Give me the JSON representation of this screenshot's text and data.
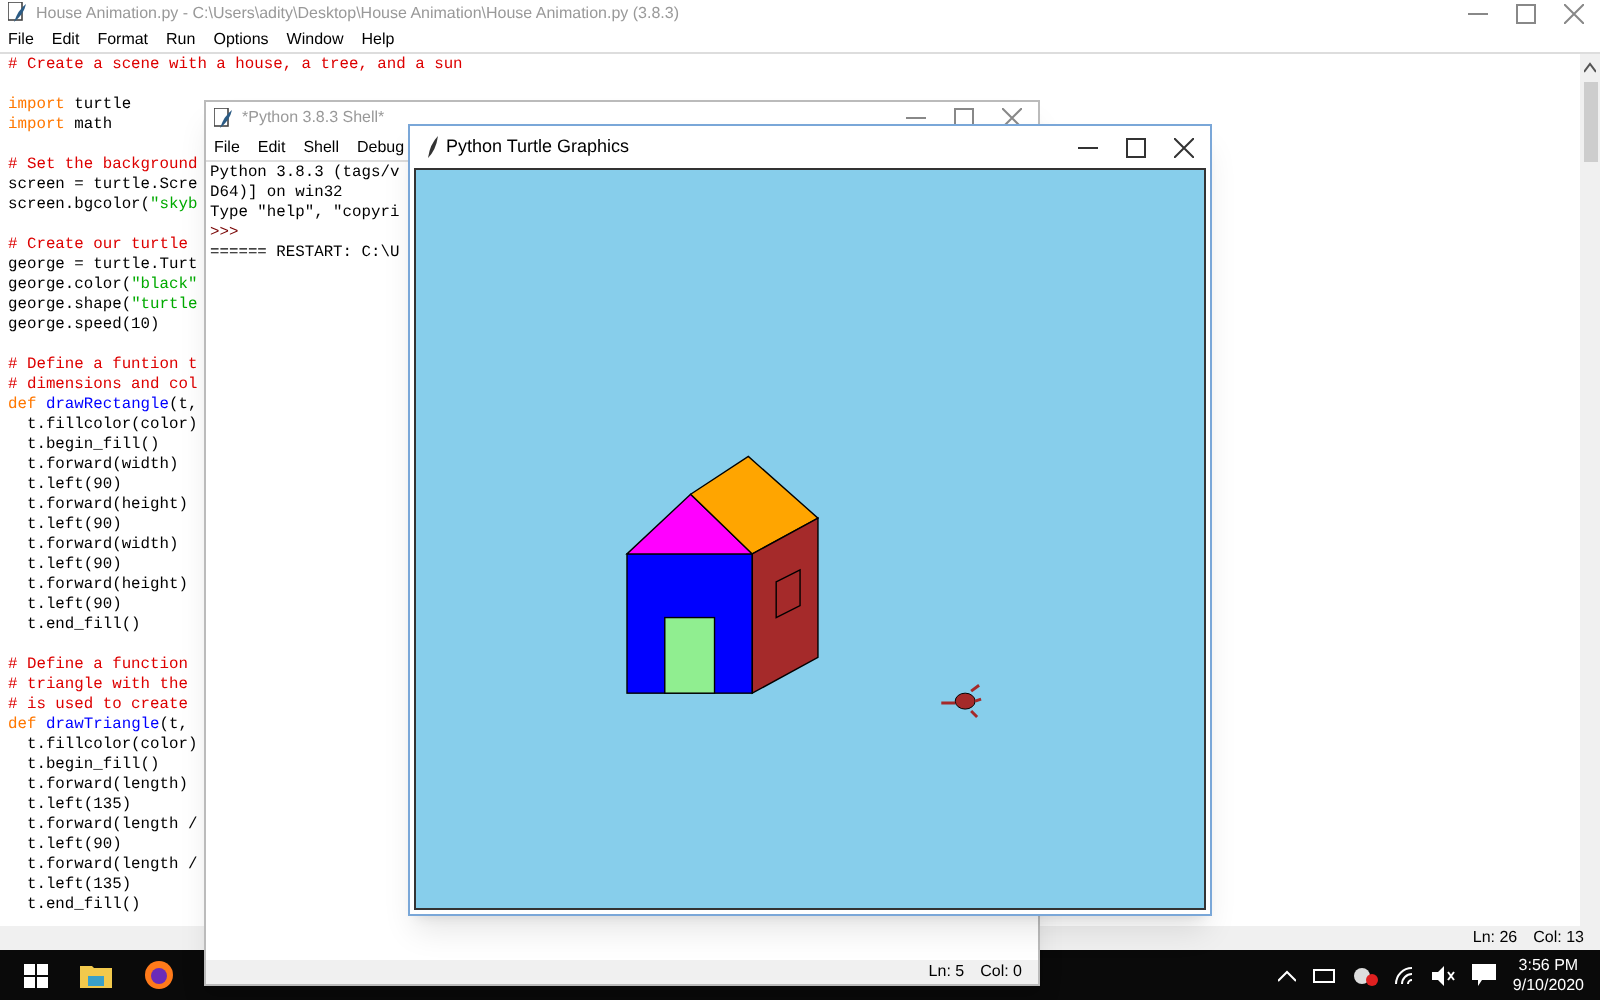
{
  "editor": {
    "title": "House Animation.py - C:\\Users\\adity\\Desktop\\House Animation\\House Animation.py (3.8.3)",
    "menu": [
      "File",
      "Edit",
      "Format",
      "Run",
      "Options",
      "Window",
      "Help"
    ],
    "code_blocks": [
      [
        [
          {
            "kind": "comment",
            "text": "# Create a scene with a house, a tree, and a sun"
          }
        ]
      ],
      [
        [
          {
            "kind": "keyword",
            "text": "import"
          },
          {
            "kind": "plain",
            "text": " turtle"
          }
        ],
        [
          {
            "kind": "keyword",
            "text": "import"
          },
          {
            "kind": "plain",
            "text": " math"
          }
        ]
      ],
      [
        [
          {
            "kind": "comment",
            "text": "# Set the background"
          }
        ],
        [
          {
            "kind": "plain",
            "text": "screen = turtle.Scre"
          }
        ],
        [
          {
            "kind": "plain",
            "text": "screen.bgcolor("
          },
          {
            "kind": "string",
            "text": "\"skyb"
          }
        ]
      ],
      [
        [
          {
            "kind": "comment",
            "text": "# Create our turtle"
          }
        ],
        [
          {
            "kind": "plain",
            "text": "george = turtle.Turt"
          }
        ],
        [
          {
            "kind": "plain",
            "text": "george.color("
          },
          {
            "kind": "string",
            "text": "\"black\""
          }
        ],
        [
          {
            "kind": "plain",
            "text": "george.shape("
          },
          {
            "kind": "string",
            "text": "\"turtle"
          }
        ],
        [
          {
            "kind": "plain",
            "text": "george.speed(10)"
          }
        ]
      ],
      [
        [
          {
            "kind": "comment",
            "text": "# Define a funtion t"
          }
        ],
        [
          {
            "kind": "comment",
            "text": "# dimensions and col"
          }
        ],
        [
          {
            "kind": "keyword",
            "text": "def"
          },
          {
            "kind": "name",
            "text": " drawRectangle"
          },
          {
            "kind": "plain",
            "text": "(t,"
          }
        ],
        [
          {
            "kind": "plain",
            "text": "  t.fillcolor(color)"
          }
        ],
        [
          {
            "kind": "plain",
            "text": "  t.begin_fill()"
          }
        ],
        [
          {
            "kind": "plain",
            "text": "  t.forward(width)"
          }
        ],
        [
          {
            "kind": "plain",
            "text": "  t.left(90)"
          }
        ],
        [
          {
            "kind": "plain",
            "text": "  t.forward(height)"
          }
        ],
        [
          {
            "kind": "plain",
            "text": "  t.left(90)"
          }
        ],
        [
          {
            "kind": "plain",
            "text": "  t.forward(width)"
          }
        ],
        [
          {
            "kind": "plain",
            "text": "  t.left(90)"
          }
        ],
        [
          {
            "kind": "plain",
            "text": "  t.forward(height)"
          }
        ],
        [
          {
            "kind": "plain",
            "text": "  t.left(90)"
          }
        ],
        [
          {
            "kind": "plain",
            "text": "  t.end_fill()"
          }
        ]
      ],
      [
        [
          {
            "kind": "comment",
            "text": "# Define a function"
          }
        ],
        [
          {
            "kind": "comment",
            "text": "# triangle with the"
          }
        ],
        [
          {
            "kind": "comment",
            "text": "# is used to create"
          }
        ],
        [
          {
            "kind": "keyword",
            "text": "def"
          },
          {
            "kind": "name",
            "text": " drawTriangle"
          },
          {
            "kind": "plain",
            "text": "(t,"
          }
        ],
        [
          {
            "kind": "plain",
            "text": "  t.fillcolor(color)"
          }
        ],
        [
          {
            "kind": "plain",
            "text": "  t.begin_fill()"
          }
        ],
        [
          {
            "kind": "plain",
            "text": "  t.forward(length)"
          }
        ],
        [
          {
            "kind": "plain",
            "text": "  t.left(135)"
          }
        ],
        [
          {
            "kind": "plain",
            "text": "  t.forward(length /"
          }
        ],
        [
          {
            "kind": "plain",
            "text": "  t.left(90)"
          }
        ],
        [
          {
            "kind": "plain",
            "text": "  t.forward(length /"
          }
        ],
        [
          {
            "kind": "plain",
            "text": "  t.left(135)"
          }
        ],
        [
          {
            "kind": "plain",
            "text": "  t.end_fill()"
          }
        ]
      ]
    ],
    "status": {
      "line": "Ln: 26",
      "column": "Col: 13"
    }
  },
  "shell": {
    "title": "*Python 3.8.3 Shell*",
    "menu": [
      "File",
      "Edit",
      "Shell",
      "Debug"
    ],
    "lines": [
      {
        "kind": "output",
        "text": "Python 3.8.3 (tags/v"
      },
      {
        "kind": "output",
        "text": "D64)] on win32"
      },
      {
        "kind": "output",
        "text": "Type \"help\", \"copyri"
      },
      {
        "kind": "prompt",
        "text": ">>>"
      },
      {
        "kind": "output",
        "text": "====== RESTART: C:\\U"
      }
    ],
    "status": {
      "line": "Ln: 5",
      "column": "Col: 0"
    }
  },
  "turtle_window": {
    "title": "Python Turtle Graphics"
  },
  "taskbar": {
    "time": "3:56 PM",
    "date": "9/10/2020"
  }
}
